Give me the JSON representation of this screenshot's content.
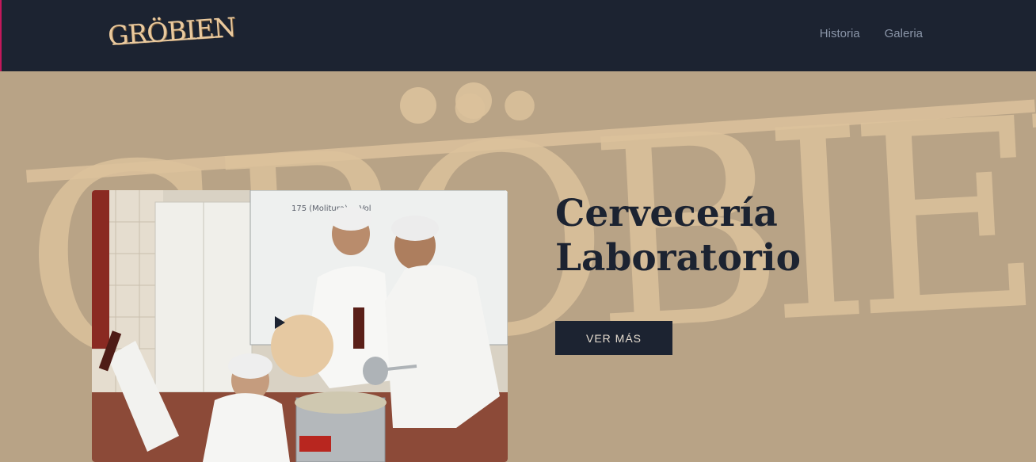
{
  "brand": {
    "logo_text": "GRÖBIEN"
  },
  "nav": {
    "items": [
      "Historia",
      "Galeria"
    ]
  },
  "hero": {
    "watermark_text": "GRÖBIEN",
    "title_line1": "Cervecería",
    "title_line2": "Laboratorio",
    "cta_label": "VER MÁS"
  },
  "photo": {
    "whiteboard_text": "175 (Molitura) = Vol"
  },
  "colors": {
    "nav_bg": "#1c2331",
    "hero_bg": "#b8a386",
    "accent": "#e6c9a2"
  },
  "icons": {
    "play": "play-icon"
  }
}
